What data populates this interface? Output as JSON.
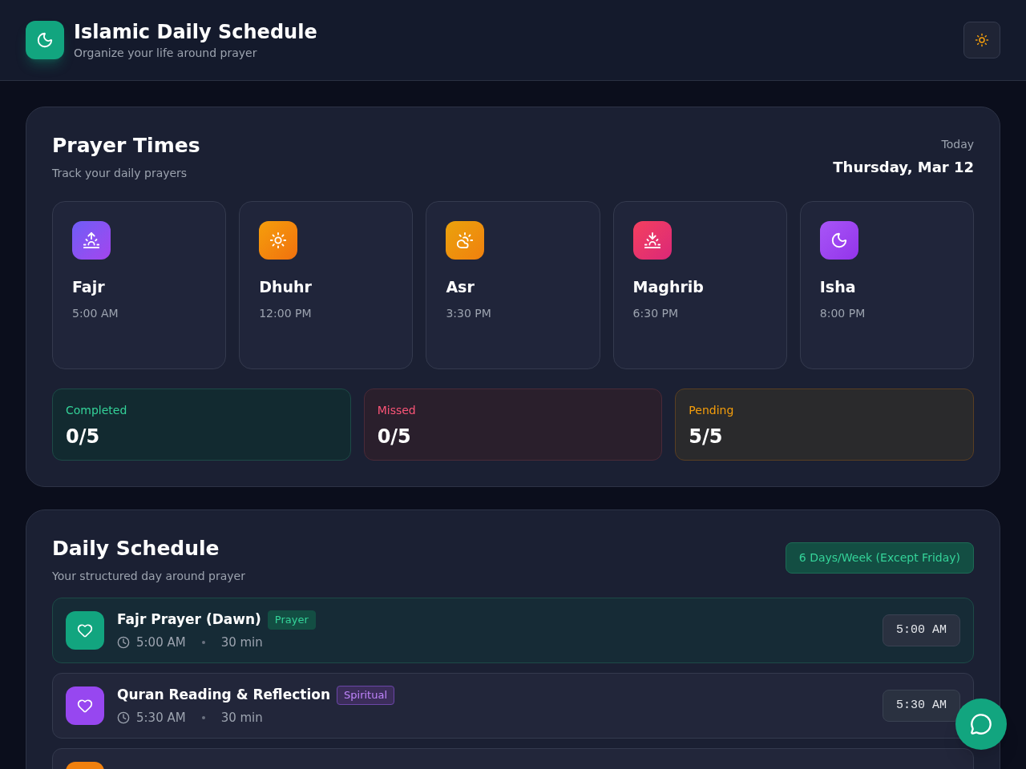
{
  "header": {
    "title": "Islamic Daily Schedule",
    "subtitle": "Organize your life around prayer"
  },
  "prayer_times": {
    "title": "Prayer Times",
    "subtitle": "Track your daily prayers",
    "date_label": "Today",
    "date": "Thursday, Mar 12",
    "prayers": [
      {
        "name": "Fajr",
        "time": "5:00 AM",
        "kind": "sunrise"
      },
      {
        "name": "Dhuhr",
        "time": "12:00 PM",
        "kind": "sun"
      },
      {
        "name": "Asr",
        "time": "3:30 PM",
        "kind": "cloud-sun"
      },
      {
        "name": "Maghrib",
        "time": "6:30 PM",
        "kind": "sunset"
      },
      {
        "name": "Isha",
        "time": "8:00 PM",
        "kind": "moon"
      }
    ],
    "stats": [
      {
        "label": "Completed",
        "value": "0/5",
        "kind": "completed"
      },
      {
        "label": "Missed",
        "value": "0/5",
        "kind": "missed"
      },
      {
        "label": "Pending",
        "value": "5/5",
        "kind": "pending"
      }
    ]
  },
  "daily_schedule": {
    "title": "Daily Schedule",
    "subtitle": "Your structured day around prayer",
    "badge": "6 Days/Week (Except Friday)",
    "items": [
      {
        "title": "Fajr Prayer (Dawn)",
        "tag": "Prayer",
        "kind": "prayer",
        "time": "5:00 AM",
        "duration": "30 min",
        "time_badge": "5:00 AM",
        "selected": true
      },
      {
        "title": "Quran Reading & Reflection",
        "tag": "Spiritual",
        "kind": "spiritual",
        "time": "5:30 AM",
        "duration": "30 min",
        "time_badge": "5:30 AM",
        "selected": false
      },
      {
        "kind": "exercise",
        "selected": false
      }
    ]
  }
}
